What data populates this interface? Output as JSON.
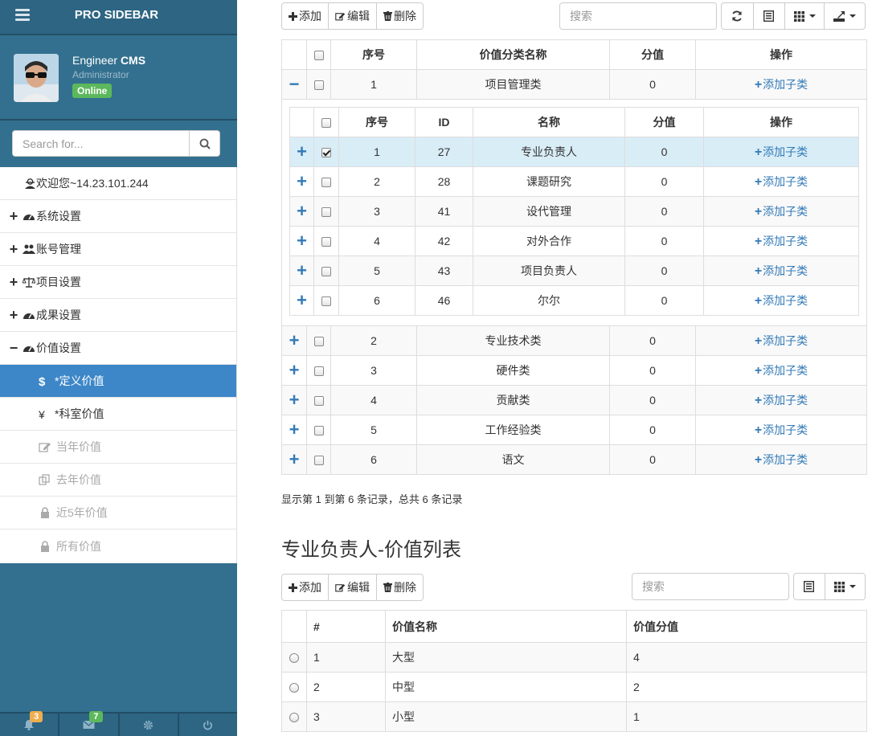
{
  "sidebar": {
    "brand": "PRO SIDEBAR",
    "user": {
      "first": "Engineer",
      "last": "CMS",
      "role": "Administrator",
      "status": "Online"
    },
    "search_placeholder": "Search for...",
    "welcome": "欢迎您~14.23.101.244",
    "items": [
      {
        "label": "系统设置",
        "sign": "+"
      },
      {
        "label": "账号管理",
        "sign": "+"
      },
      {
        "label": "项目设置",
        "sign": "+"
      },
      {
        "label": "成果设置",
        "sign": "+"
      },
      {
        "label": "价值设置",
        "sign": "−"
      }
    ],
    "subitems": [
      {
        "label": "*定义价值",
        "glyph": "$"
      },
      {
        "label": "*科室价值",
        "glyph": "¥"
      },
      {
        "label": "当年价值"
      },
      {
        "label": "去年价值"
      },
      {
        "label": "近5年价值"
      },
      {
        "label": "所有价值"
      }
    ],
    "footer": {
      "notifications": "3",
      "messages": "7",
      "notif_color": "#f0ad4e",
      "msg_color": "#5cb85c"
    }
  },
  "toolbar1": {
    "add": "添加",
    "edit": "编辑",
    "delete": "删除",
    "search_placeholder": "搜索"
  },
  "main_table": {
    "headers": [
      "序号",
      "价值分类名称",
      "分值",
      "操作"
    ],
    "expanded_row": {
      "no": "1",
      "name": "项目管理类",
      "score": "0",
      "action": "添加子类"
    },
    "rows": [
      {
        "no": "2",
        "name": "专业技术类",
        "score": "0",
        "action": "添加子类"
      },
      {
        "no": "3",
        "name": "硬件类",
        "score": "0",
        "action": "添加子类"
      },
      {
        "no": "4",
        "name": "贡献类",
        "score": "0",
        "action": "添加子类"
      },
      {
        "no": "5",
        "name": "工作经验类",
        "score": "0",
        "action": "添加子类"
      },
      {
        "no": "6",
        "name": "语文",
        "score": "0",
        "action": "添加子类"
      }
    ]
  },
  "sub_table": {
    "headers": [
      "序号",
      "ID",
      "名称",
      "分值",
      "操作"
    ],
    "rows": [
      {
        "no": "1",
        "id": "27",
        "name": "专业负责人",
        "score": "0",
        "action": "添加子类"
      },
      {
        "no": "2",
        "id": "28",
        "name": "课题研究",
        "score": "0",
        "action": "添加子类"
      },
      {
        "no": "3",
        "id": "41",
        "name": "设代管理",
        "score": "0",
        "action": "添加子类"
      },
      {
        "no": "4",
        "id": "42",
        "name": "对外合作",
        "score": "0",
        "action": "添加子类"
      },
      {
        "no": "5",
        "id": "43",
        "name": "项目负责人",
        "score": "0",
        "action": "添加子类"
      },
      {
        "no": "6",
        "id": "46",
        "name": "尔尔",
        "score": "0",
        "action": "添加子类"
      }
    ]
  },
  "pagination_info": "显示第 1 到第 6 条记录，总共 6 条记录",
  "section_title": "专业负责人-价值列表",
  "toolbar2": {
    "add": "添加",
    "edit": "编辑",
    "delete": "删除",
    "search_placeholder": "搜索"
  },
  "value_table": {
    "headers": [
      "#",
      "价值名称",
      "价值分值"
    ],
    "rows": [
      {
        "no": "1",
        "name": "大型",
        "score": "4"
      },
      {
        "no": "2",
        "name": "中型",
        "score": "2"
      },
      {
        "no": "3",
        "name": "小型",
        "score": "1"
      }
    ]
  }
}
